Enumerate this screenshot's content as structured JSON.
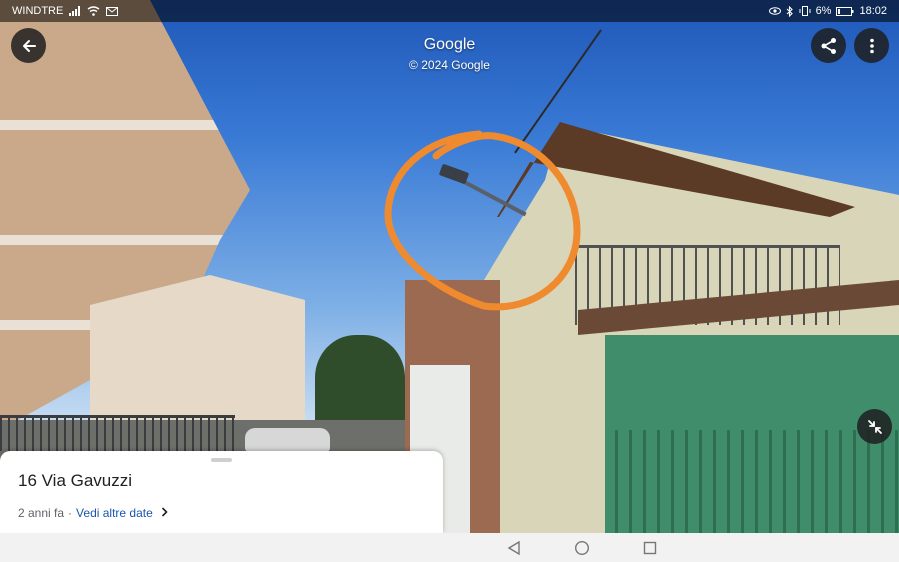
{
  "status_bar": {
    "carrier": "WINDTRE",
    "battery_percent": "6%",
    "time": "18:02"
  },
  "header": {
    "title": "Google",
    "copyright": "© 2024 Google"
  },
  "card": {
    "address": "16 Via Gavuzzi",
    "age": "2 anni fa",
    "separator": "·",
    "more_dates_link": "Vedi altre date"
  },
  "icons": {
    "back": "arrow-back-icon",
    "share": "share-icon",
    "more": "more-vert-icon",
    "collapse": "collapse-icon",
    "nav_back": "nav-back-icon",
    "nav_home": "nav-home-icon",
    "nav_recents": "nav-recents-icon"
  },
  "colors": {
    "link": "#1a56a8",
    "annotation_circle": "#f08a2e"
  }
}
